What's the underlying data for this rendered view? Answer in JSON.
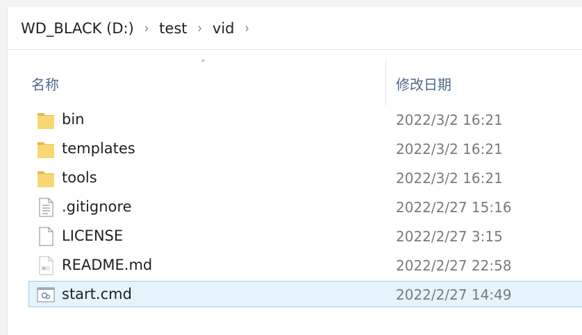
{
  "breadcrumb": [
    "WD_BLACK (D:)",
    "test",
    "vid"
  ],
  "columns": {
    "name": "名称",
    "modified": "修改日期"
  },
  "files": [
    {
      "name": "bin",
      "modified": "2022/3/2 16:21",
      "icon": "folder-icon"
    },
    {
      "name": "templates",
      "modified": "2022/3/2 16:21",
      "icon": "folder-icon"
    },
    {
      "name": "tools",
      "modified": "2022/3/2 16:21",
      "icon": "folder-icon"
    },
    {
      "name": ".gitignore",
      "modified": "2022/2/27 15:16",
      "icon": "text-file-icon"
    },
    {
      "name": "LICENSE",
      "modified": "2022/2/27 3:15",
      "icon": "blank-file-icon"
    },
    {
      "name": "README.md",
      "modified": "2022/2/27 22:58",
      "icon": "markdown-file-icon"
    },
    {
      "name": "start.cmd",
      "modified": "2022/2/27 14:49",
      "icon": "cmd-file-icon",
      "selected": true
    }
  ],
  "colors": {
    "selection_bg": "#e5f3fb",
    "selection_border": "#9dcbeb",
    "folder": "#f8d775",
    "header_text": "#4d6a8a"
  }
}
